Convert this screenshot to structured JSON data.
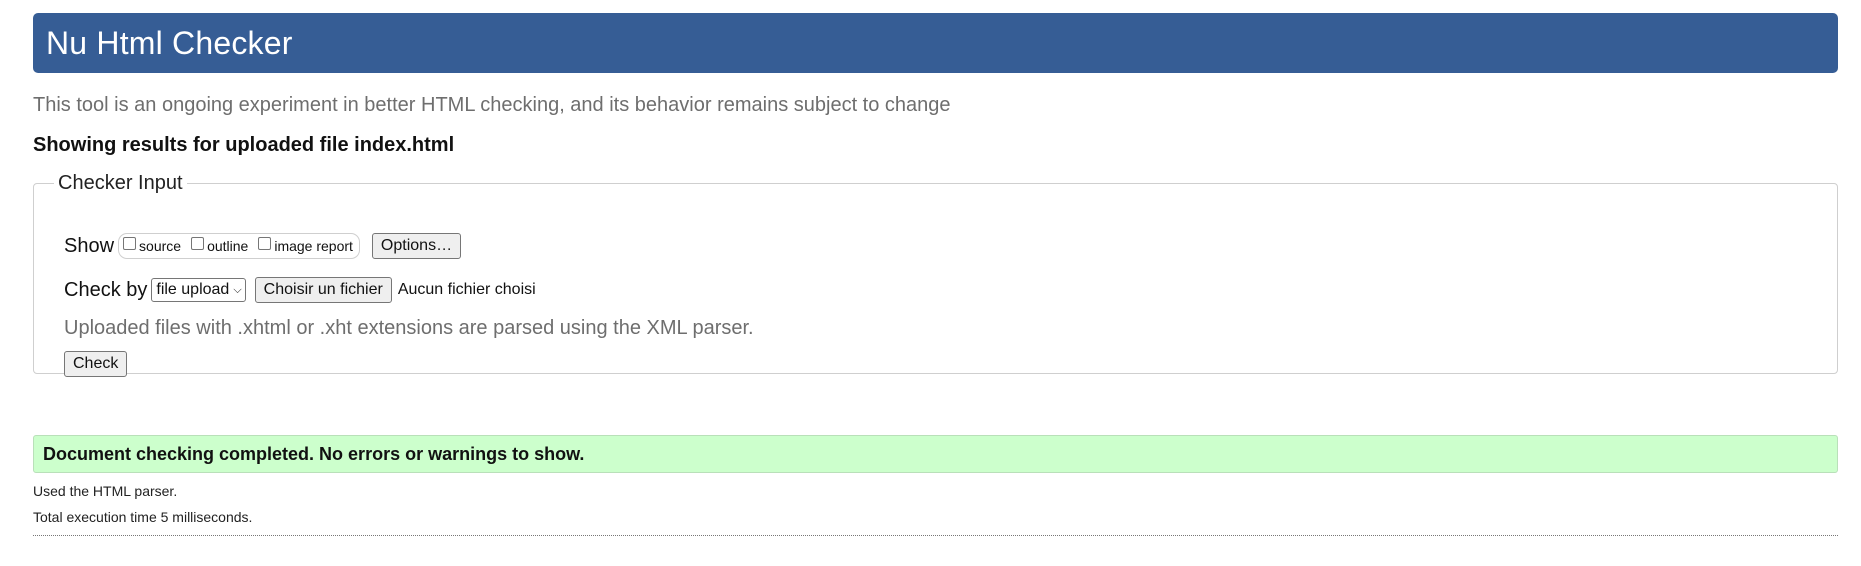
{
  "header": {
    "title": "Nu Html Checker"
  },
  "intro": "This tool is an ongoing experiment in better HTML checking, and its behavior remains subject to change",
  "results_heading": "Showing results for uploaded file index.html",
  "checker_input": {
    "legend": "Checker Input",
    "show_label": "Show",
    "show_options": [
      {
        "label": "source",
        "checked": false
      },
      {
        "label": "outline",
        "checked": false
      },
      {
        "label": "image report",
        "checked": false
      }
    ],
    "options_button": "Options…",
    "check_by_label": "Check by",
    "check_by_value": "file upload",
    "file_button": "Choisir un fichier",
    "file_status": "Aucun fichier choisi",
    "note": "Uploaded files with .xhtml or .xht extensions are parsed using the XML parser.",
    "check_button": "Check"
  },
  "result": {
    "message": "Document checking completed. No errors or warnings to show.",
    "status_color": "#ccffcc"
  },
  "details": {
    "parser": "Used the HTML parser.",
    "execution_time": "Total execution time 5 milliseconds."
  },
  "colors": {
    "header_bg": "#365d95",
    "success_bg": "#ccffcc"
  }
}
